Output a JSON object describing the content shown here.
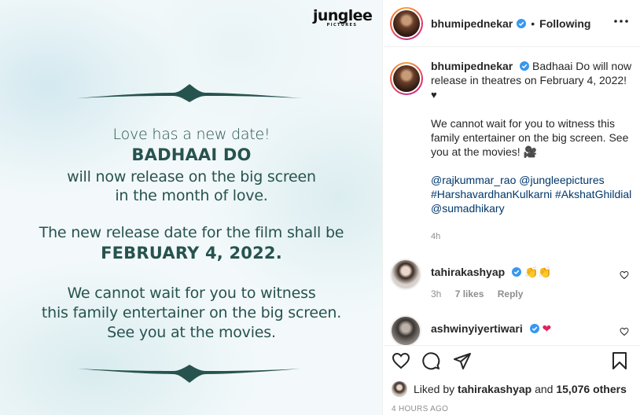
{
  "post_image": {
    "logo_word": "junglee",
    "logo_sub": "PICTURES",
    "lines": {
      "l1": "Love has a new date!",
      "l2": "BADHAAI DO",
      "l3": "will now release on the big screen",
      "l3b": "in the month of love.",
      "l4": "The new release date for the film shall be",
      "l5": "FEBRUARY 4, 2022.",
      "l6": "We cannot wait for you to witness",
      "l6b": "this family entertainer on the big screen.",
      "l6c": "See you at the movies."
    }
  },
  "header": {
    "username": "bhumipednekar",
    "separator": "•",
    "follow_status": "Following"
  },
  "caption": {
    "username": "bhumipednekar",
    "text1": "Badhaai Do will now release in theatres on February 4, 2022!",
    "heart": "♥",
    "text2": "We cannot wait for you to witness this family entertainer on the big screen. See you at the movies!",
    "camera": "🎥",
    "tags": [
      "@rajkummar_rao",
      "@jungleepictures",
      "#HarshavardhanKulkarni",
      "#AkshatGhildial",
      "@sumadhikary"
    ],
    "time": "4h"
  },
  "comments": [
    {
      "username": "tahirakashyap",
      "emoji": "👏👏",
      "time": "3h",
      "likes": "7 likes",
      "reply": "Reply"
    },
    {
      "username": "ashwinyiyertiwari",
      "emoji": "❤"
    }
  ],
  "likes": {
    "prefix": "Liked by",
    "user": "tahirakashyap",
    "middle": "and",
    "others": "15,076 others"
  },
  "posted_time": "4 HOURS AGO",
  "colors": {
    "poster_text": "#27534f",
    "verified": "#3897f0",
    "link": "#00376b",
    "meta": "#8e8e8e"
  }
}
